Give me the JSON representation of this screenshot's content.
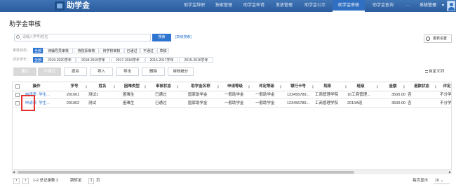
{
  "app": {
    "title": "助学金"
  },
  "nav": {
    "items": [
      "助学金辞职",
      "独家管理",
      "助学金申请",
      "发放管理",
      "助学金公示",
      "助学金审核",
      "助学金查询",
      "···"
    ],
    "admin": "系统管理",
    "caret": "▼"
  },
  "page": {
    "title": "助学金审核"
  },
  "search": {
    "placeholder": "请输入学号/姓名",
    "button": "搜索",
    "advanced": "[高级搜索]",
    "settings": "报表设置"
  },
  "filters": {
    "status_label": "审核状态：",
    "status_options": [
      "全部",
      "待辅导员审核",
      "待院系审核",
      "待学校审核",
      "已通过",
      "不通过",
      "草稿"
    ],
    "year_label": "评定学年：",
    "year_options": [
      "全部",
      "2019-2020学年",
      "2018-2019学年",
      "2017-2018学年",
      "2016-2017学年",
      "2015-2016学年"
    ]
  },
  "toolbar": {
    "buttons": [
      "通过",
      "不通过",
      "提名",
      "导入",
      "导出",
      "删除",
      "审核统计"
    ],
    "custom_columns": "自定义列"
  },
  "table": {
    "headers": [
      "操作",
      "学号",
      "姓名",
      "困难类型",
      "审核状态",
      "助学金名称",
      "申请等级",
      "评定等级",
      "银行卡号",
      "院系",
      "班级",
      "金额",
      "退款状态",
      "评定"
    ],
    "rows": [
      {
        "action": "申请表",
        "action2": "学生...",
        "id": "201001",
        "name": "测试1",
        "type": "困难生",
        "status": "已通过",
        "grant": "国家助学金",
        "apply": "一般助学金",
        "level": "一般助学金",
        "card": "123456789...",
        "dept": "工商管理学院",
        "class": "16工商管理...",
        "amount": "3500.00",
        "refund": "否",
        "extra": "不分学"
      },
      {
        "action": "申请表",
        "action2": "学生...",
        "id": "201002",
        "name": "测试",
        "type": "困难生",
        "status": "已通过",
        "grant": "国家助学金",
        "apply": "一般助学金",
        "level": "一般助学金",
        "card": "123456789...",
        "dept": "工商管理学院",
        "class": "2010A班",
        "amount": "3500.00",
        "refund": "否",
        "extra": "不分学"
      }
    ]
  },
  "footer": {
    "range": "1-2 总记录数 2",
    "goto": "跳转至",
    "page_num": "1",
    "page_unit": "页",
    "per_page_label": "每页显示",
    "per_page_value": "10"
  },
  "colors": {
    "primary": "#2e75cf",
    "nav": "#2b5c9e",
    "highlight": "#e3342f"
  }
}
